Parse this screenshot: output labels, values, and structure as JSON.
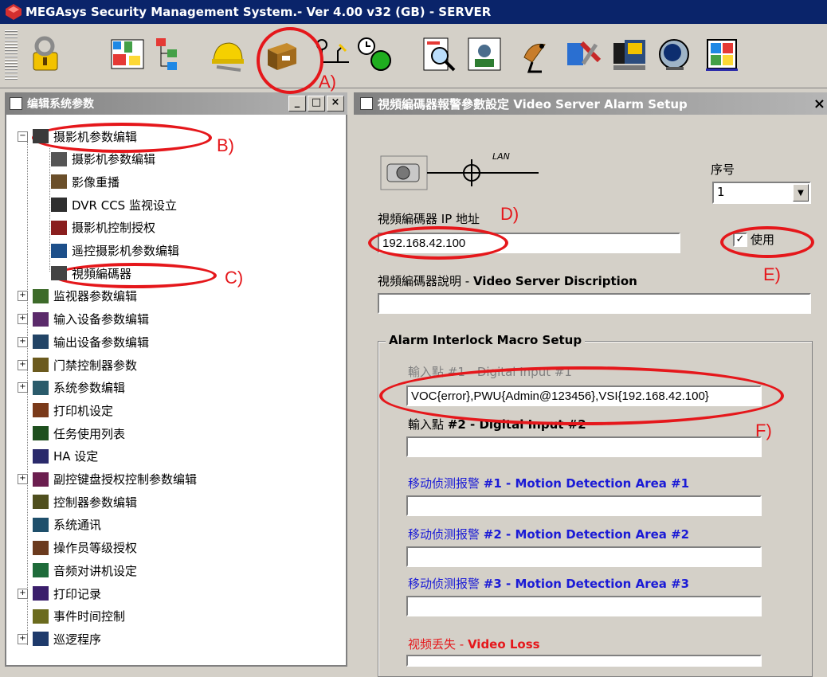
{
  "window": {
    "title": "MEGAsys Security Management System.- Ver 4.00 v32  (GB)  - SERVER"
  },
  "toolbar": {
    "icons": [
      "keys-icon",
      "layout-icon",
      "tree-icon",
      "hardhat-icon",
      "file-cabinet-icon",
      "network-icon",
      "clock-icon",
      "report-icon",
      "profile-icon",
      "satellite-icon",
      "tools-icon",
      "video-icon",
      "monitor-icon",
      "grid-icon"
    ]
  },
  "left_pane": {
    "caption": "编辑系统参数",
    "btn_minimize": "_",
    "btn_maximize": "□",
    "btn_close": "×",
    "tree": [
      {
        "label": "摄影机参数编辑",
        "level": 0,
        "expand": "−"
      },
      {
        "label": "摄影机参数编辑",
        "level": 1
      },
      {
        "label": "影像重播",
        "level": 1
      },
      {
        "label": "DVR CCS 监视设立",
        "level": 1
      },
      {
        "label": "摄影机控制授权",
        "level": 1
      },
      {
        "label": "遥控摄影机参数编辑",
        "level": 1
      },
      {
        "label": "視頻編碼器",
        "level": 1
      },
      {
        "label": "监视器参数编辑",
        "level": 0,
        "expand": "+"
      },
      {
        "label": "输入设备参数编辑",
        "level": 0,
        "expand": "+"
      },
      {
        "label": "输出设备参数编辑",
        "level": 0,
        "expand": "+"
      },
      {
        "label": "门禁控制器参数",
        "level": 0,
        "expand": "+"
      },
      {
        "label": "系统参数编辑",
        "level": 0,
        "expand": "+"
      },
      {
        "label": "打印机设定",
        "level": 0
      },
      {
        "label": "任务使用列表",
        "level": 0
      },
      {
        "label": "HA 设定",
        "level": 0
      },
      {
        "label": "副控键盘授权控制参数编辑",
        "level": 0,
        "expand": "+"
      },
      {
        "label": "控制器参数编辑",
        "level": 0
      },
      {
        "label": "系统通讯",
        "level": 0
      },
      {
        "label": "操作员等级授权",
        "level": 0
      },
      {
        "label": "音频对讲机设定",
        "level": 0
      },
      {
        "label": "打印记录",
        "level": 0,
        "expand": "+"
      },
      {
        "label": "事件时间控制",
        "level": 0
      },
      {
        "label": "巡逻程序",
        "level": 0,
        "expand": "+"
      }
    ]
  },
  "right_pane": {
    "caption": "視頻編碼器報警參數設定 Video Server Alarm Setup",
    "close": "×",
    "lan_label": "LAN",
    "seq_label": "序号",
    "seq_value": "1",
    "ip_label": "視頻編碼器 IP 地址",
    "ip_value": "192.168.42.100",
    "use_label": "使用",
    "use_checked": "✓",
    "desc_label_cn": "視頻編碼器說明 - ",
    "desc_label_en": "Video Server Discription",
    "desc_value": "",
    "group_title": "Alarm Interlock Macro Setup",
    "input1_label": "輸入點 #1 - Digital Input #1",
    "input1_value": "VOC{error},PWU{Admin@123456},VSI{192.168.42.100}",
    "input2_label_cn": "輸入點 ",
    "input2_label_en": "#2 - Digital Input #2",
    "input2_value": "",
    "motion1_cn": "移动侦测报警 ",
    "motion1_en": "#1 - Motion Detection Area #1",
    "motion1_value": "",
    "motion2_cn": "移动侦测报警 ",
    "motion2_en": "#2 - Motion Detection Area #2",
    "motion2_value": "",
    "motion3_cn": "移动侦测报警 ",
    "motion3_en": "#3 - Motion Detection Area #3",
    "motion3_value": "",
    "videoloss_cn": "视频丢失 - ",
    "videoloss_en": "Video Loss",
    "videoloss_value": ""
  },
  "annotations": {
    "a": "A)",
    "b": "B)",
    "c": "C)",
    "d": "D)",
    "e": "E)",
    "f": "F)",
    "color": "#e5171b"
  }
}
